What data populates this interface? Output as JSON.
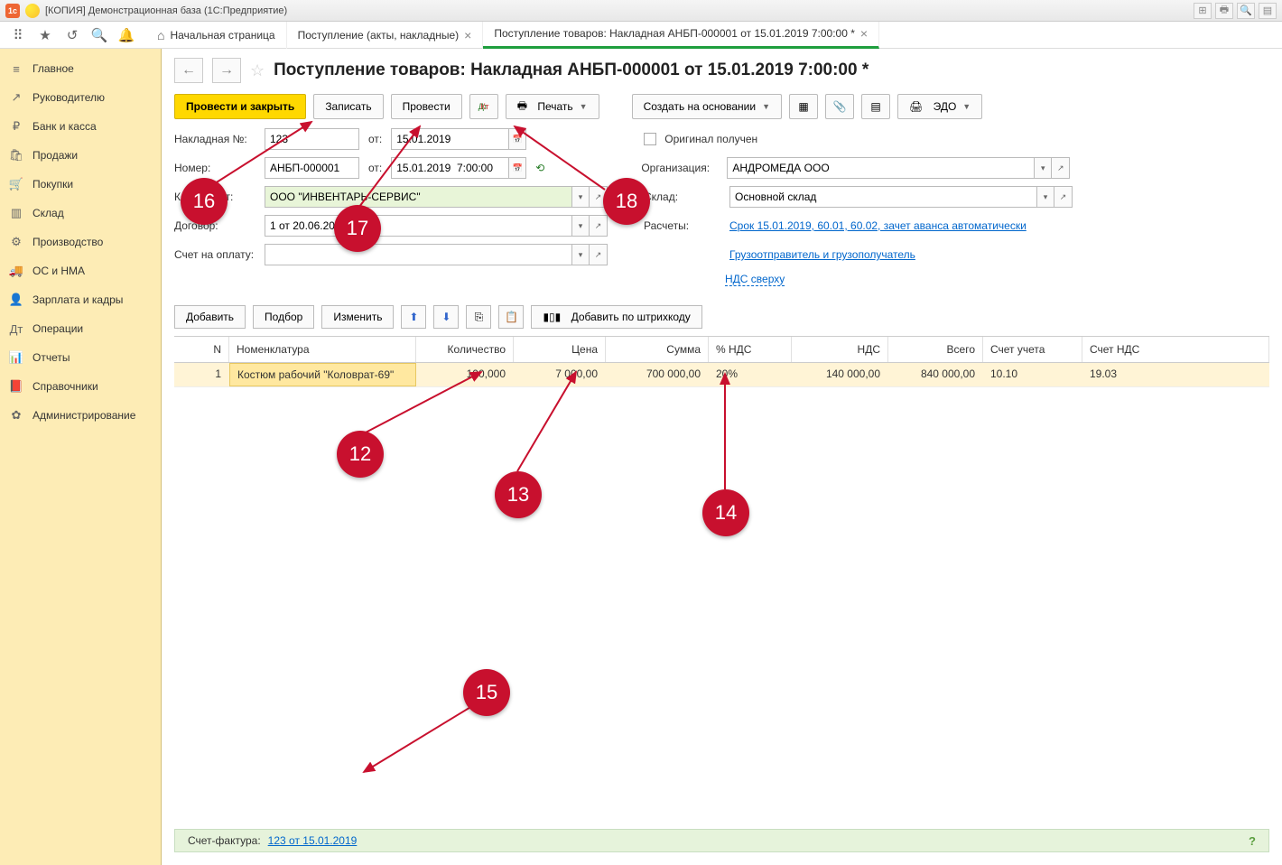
{
  "window_title": "[КОПИЯ] Демонстрационная база  (1С:Предприятие)",
  "app_icon": "1c",
  "tabs": [
    {
      "label": "Начальная страница",
      "home": true
    },
    {
      "label": "Поступление (акты, накладные)",
      "closable": true
    },
    {
      "label": "Поступление товаров: Накладная АНБП-000001 от 15.01.2019 7:00:00 *",
      "closable": true,
      "active": true
    }
  ],
  "sidebar": [
    {
      "icon": "≡",
      "label": "Главное"
    },
    {
      "icon": "↗",
      "label": "Руководителю"
    },
    {
      "icon": "₽",
      "label": "Банк и касса"
    },
    {
      "icon": "🛍",
      "label": "Продажи"
    },
    {
      "icon": "🛒",
      "label": "Покупки"
    },
    {
      "icon": "▥",
      "label": "Склад"
    },
    {
      "icon": "⚙",
      "label": "Производство"
    },
    {
      "icon": "🚚",
      "label": "ОС и НМА"
    },
    {
      "icon": "👤",
      "label": "Зарплата и кадры"
    },
    {
      "icon": "Дт",
      "label": "Операции"
    },
    {
      "icon": "📊",
      "label": "Отчеты"
    },
    {
      "icon": "📕",
      "label": "Справочники"
    },
    {
      "icon": "✿",
      "label": "Администрирование"
    }
  ],
  "doc": {
    "title": "Поступление товаров: Накладная АНБП-000001 от 15.01.2019 7:00:00 *",
    "actions": {
      "primary": "Провести и закрыть",
      "save": "Записать",
      "post": "Провести",
      "print": "Печать",
      "create_based": "Создать на основании",
      "edo": "ЭДО"
    },
    "fields": {
      "invoice_label": "Накладная №:",
      "invoice_no": "123",
      "invoice_from": "от:",
      "invoice_date": "15.01.2019",
      "original_received": "Оригинал получен",
      "number_label": "Номер:",
      "number": "АНБП-000001",
      "number_from": "от:",
      "number_date": "15.01.2019  7:00:00",
      "org_label": "Организация:",
      "org": "АНДРОМЕДА ООО",
      "contractor_label": "Контрагент:",
      "contractor": "ООО \"ИНВЕНТАРЬ-СЕРВИС\"",
      "warehouse_label": "Склад:",
      "warehouse": "Основной склад",
      "contract_label": "Договор:",
      "contract": "1 от 20.06.2018",
      "settlements_label": "Расчеты:",
      "settlements_link": "Срок 15.01.2019, 60.01, 60.02, зачет аванса автоматически",
      "invoice_pay_label": "Счет на оплату:",
      "consignor_link": "Грузоотправитель и грузополучатель",
      "vat_link": "НДС сверху"
    }
  },
  "table_toolbar": {
    "add": "Добавить",
    "select": "Подбор",
    "edit": "Изменить",
    "barcode": "Добавить по штрихкоду"
  },
  "table": {
    "columns": [
      "N",
      "Номенклатура",
      "Количество",
      "Цена",
      "Сумма",
      "% НДС",
      "НДС",
      "Всего",
      "Счет учета",
      "Счет НДС"
    ],
    "rows": [
      {
        "n": "1",
        "nom": "Костюм рабочий \"Коловрат-69\"",
        "qty": "100,000",
        "price": "7 000,00",
        "sum": "700 000,00",
        "vat_pct": "20%",
        "vat": "140 000,00",
        "total": "840 000,00",
        "acc": "10.10",
        "vacc": "19.03"
      }
    ]
  },
  "footer": {
    "label": "Счет-фактура:",
    "link": "123 от 15.01.2019"
  },
  "badges": {
    "12": "12",
    "13": "13",
    "14": "14",
    "15": "15",
    "16": "16",
    "17": "17",
    "18": "18"
  }
}
